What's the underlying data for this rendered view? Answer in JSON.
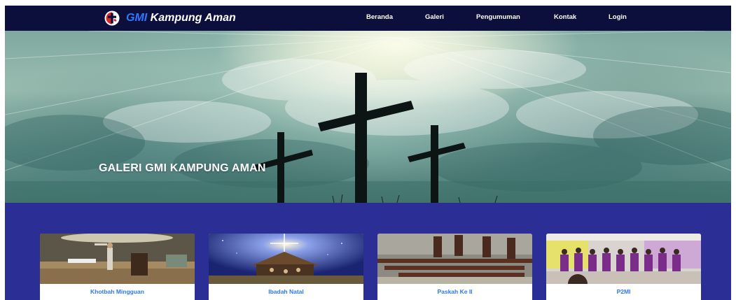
{
  "navbar": {
    "brand_accent": "GMI",
    "brand_name": "Kampung Aman",
    "logo_icon": "church-cross-logo-icon",
    "items": [
      {
        "label": "Beranda"
      },
      {
        "label": "Galeri"
      },
      {
        "label": "Pengumuman"
      },
      {
        "label": "Kontak"
      },
      {
        "label": "Login"
      }
    ]
  },
  "hero": {
    "title": "GALERI GMI KAMPUNG AMAN",
    "image": "three-crosses-sky-image"
  },
  "gallery": {
    "cards": [
      {
        "caption": "Khotbah Mingguan",
        "image": "preacher-stage-photo"
      },
      {
        "caption": "Ibadah Natal",
        "image": "nativity-scene-photo"
      },
      {
        "caption": "Paskah Ke II",
        "image": "church-pews-photo"
      },
      {
        "caption": "P2MI",
        "image": "choir-group-photo"
      }
    ]
  },
  "colors": {
    "navbar_bg": "#0c0f3c",
    "brand_accent": "#2e78ff",
    "gallery_bg": "#2b2f95",
    "caption_text": "#2f78e6"
  }
}
